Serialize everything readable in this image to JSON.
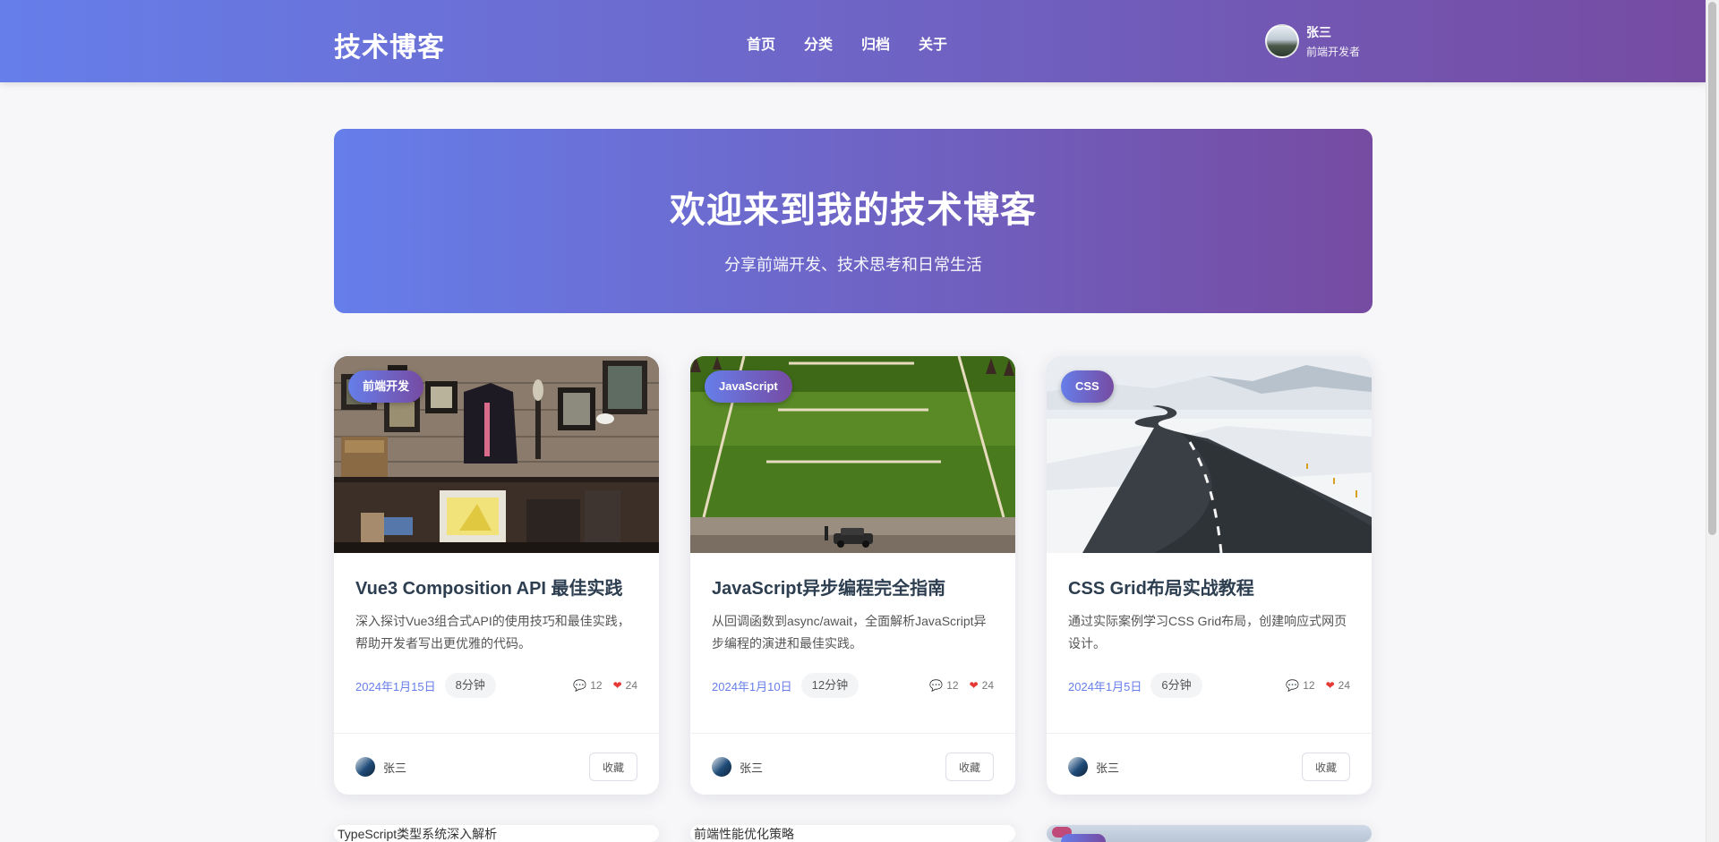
{
  "header": {
    "logo": "技术博客",
    "nav": [
      "首页",
      "分类",
      "归档",
      "关于"
    ],
    "user": {
      "name": "张三",
      "role": "前端开发者"
    }
  },
  "hero": {
    "title": "欢迎来到我的技术博客",
    "subtitle": "分享前端开发、技术思考和日常生活"
  },
  "posts": [
    {
      "tag": "前端开发",
      "title": "Vue3 Composition API 最佳实践",
      "description": "深入探讨Vue3组合式API的使用技巧和最佳实践，帮助开发者写出更优雅的代码。",
      "date": "2024年1月15日",
      "read_time": "8分钟",
      "comments": "12",
      "likes": "24",
      "author": "张三",
      "favorite_label": "收藏",
      "image": "shop-wall-icon"
    },
    {
      "tag": "JavaScript",
      "title": "JavaScript异步编程完全指南",
      "description": "从回调函数到async/await，全面解析JavaScript异步编程的演进和最佳实践。",
      "date": "2024年1月10日",
      "read_time": "12分钟",
      "comments": "12",
      "likes": "24",
      "author": "张三",
      "favorite_label": "收藏",
      "image": "field-car-icon"
    },
    {
      "tag": "CSS",
      "title": "CSS Grid布局实战教程",
      "description": "通过实际案例学习CSS Grid布局，创建响应式网页设计。",
      "date": "2024年1月5日",
      "read_time": "6分钟",
      "comments": "12",
      "likes": "24",
      "author": "张三",
      "favorite_label": "收藏",
      "image": "snow-road-icon"
    }
  ],
  "partial_posts": [
    {
      "alt": "TypeScript类型系统深入解析"
    },
    {
      "alt": "前端性能优化策略"
    }
  ],
  "colors": {
    "accent_start": "#667eea",
    "accent_end": "#764ba2",
    "like": "#e53935"
  }
}
